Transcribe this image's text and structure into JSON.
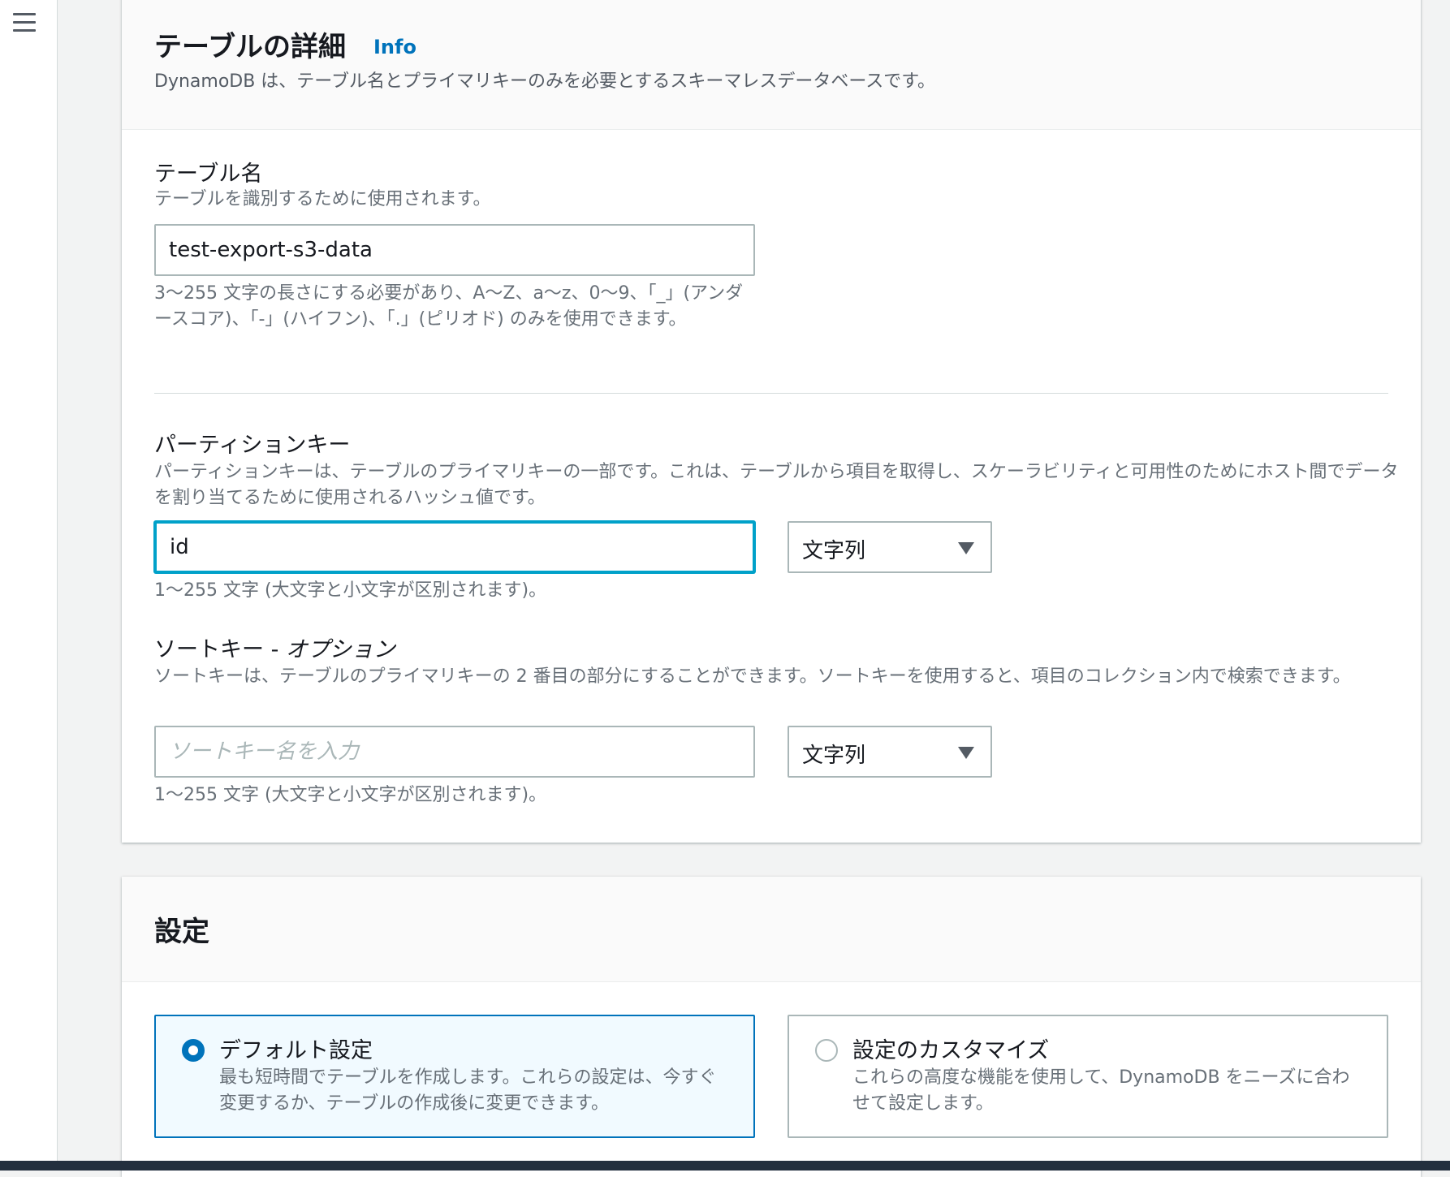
{
  "table_details": {
    "title": "テーブルの詳細",
    "info_link": "Info",
    "description": "DynamoDB は、テーブル名とプライマリキーのみを必要とするスキーマレスデータベースです。",
    "table_name": {
      "label": "テーブル名",
      "description": "テーブルを識別するために使用されます。",
      "value": "test-export-s3-data",
      "constraint": "3〜255 文字の長さにする必要があり、A〜Z、a〜z、0〜9、「_」(アンダースコア)、「-」(ハイフン)、「.」(ピリオド) のみを使用できます。"
    },
    "partition_key": {
      "label": "パーティションキー",
      "description": "パーティションキーは、テーブルのプライマリキーの一部です。これは、テーブルから項目を取得し、スケーラビリティと可用性のためにホスト間でデータを割り当てるために使用されるハッシュ値です。",
      "value": "id",
      "type": "文字列",
      "constraint": "1〜255 文字 (大文字と小文字が区別されます)。"
    },
    "sort_key": {
      "label": "ソートキー - ",
      "label_optional": "オプション",
      "description": "ソートキーは、テーブルのプライマリキーの 2 番目の部分にすることができます。ソートキーを使用すると、項目のコレクション内で検索できます。",
      "value": "",
      "placeholder": "ソートキー名を入力",
      "type": "文字列",
      "constraint": "1〜255 文字 (大文字と小文字が区別されます)。"
    }
  },
  "settings": {
    "title": "設定",
    "options": [
      {
        "title": "デフォルト設定",
        "description": "最も短時間でテーブルを作成します。これらの設定は、今すぐ変更するか、テーブルの作成後に変更できます。",
        "selected": true
      },
      {
        "title": "設定のカスタマイズ",
        "description": "これらの高度な機能を使用して、DynamoDB をニーズに合わせて設定します。",
        "selected": false
      }
    ]
  },
  "colors": {
    "accent": "#0073bb",
    "focus": "#00a1c9",
    "text": "#16191f",
    "secondary_text": "#687078"
  },
  "icons": {
    "menu": "hamburger-menu-icon",
    "select_caret": "caret-down-icon"
  }
}
